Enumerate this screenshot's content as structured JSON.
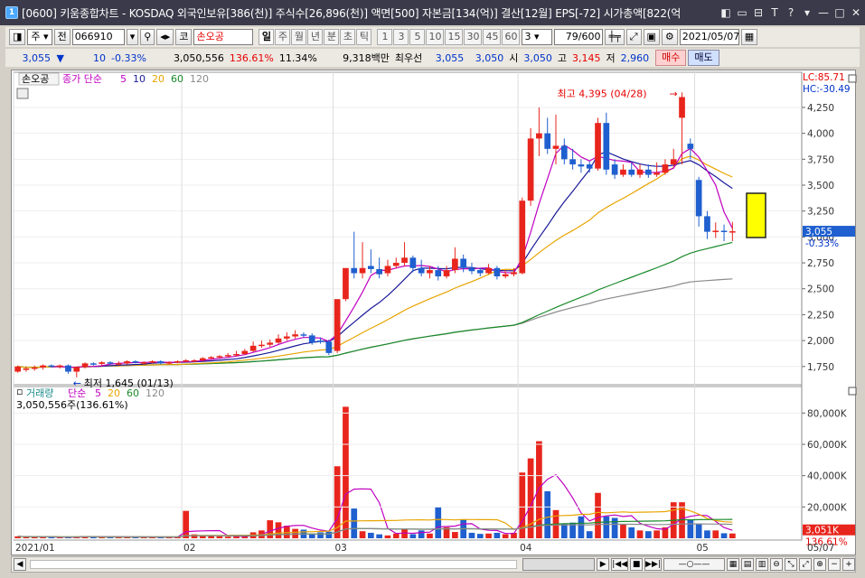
{
  "window": {
    "title": "[0600] 키움종합차트 - KOSDAQ 외국인보유[386(천)] 주식수[26,896(천)] 액면[500] 자본금[134(억)] 결산[12월] EPS[-72] 시가총액[822(억"
  },
  "toolbar": {
    "period_label": "주",
    "prev_label": "전",
    "code_value": "066910",
    "market_label": "코",
    "stock_name": "손오공",
    "period_tabs": [
      "일",
      "주",
      "월",
      "년",
      "분",
      "초",
      "틱"
    ],
    "active_tab": "일",
    "interval_buttons": [
      "1",
      "3",
      "5",
      "10",
      "15",
      "30",
      "45",
      "60"
    ],
    "interval_value": "3",
    "count_value": "79/600",
    "date_value": "2021/05/07"
  },
  "quote": {
    "price": "3,055",
    "change": "10",
    "change_pct": "-0.33%",
    "volume": "3,050,556",
    "vol_ratio": "136.61%",
    "turnover": "11.34%",
    "amount": "9,318백만",
    "best_label": "최우선",
    "best_ask": "3,055",
    "best_bid": "3,050",
    "open_label": "시",
    "open": "3,050",
    "high_label": "고",
    "high": "3,145",
    "low_label": "저",
    "low": "2,960",
    "buy_label": "매수",
    "sell_label": "매도"
  },
  "colors": {
    "up": "#e8251c",
    "down": "#1f5fcf",
    "ma5": "#c000c0",
    "ma10": "#1a1a9a",
    "ma20": "#e8a400",
    "ma60": "#1a8a2a",
    "ma120": "#8a8a8a"
  },
  "price_panel": {
    "legend_name": "손오공",
    "legend_ma": "종가 단순",
    "legend_periods": [
      "5",
      "10",
      "20",
      "60",
      "120"
    ],
    "lc_label": "LC:85.71",
    "hc_label": "HC:-30.49",
    "high_annotation": "최고 4,395 (04/28)",
    "low_annotation": "최저 1,645 (01/13)",
    "current_price": "3,055",
    "current_pct": "-0.33%",
    "yticks": [
      "4,250",
      "4,000",
      "3,750",
      "3,500",
      "3,250",
      "3,000",
      "2,750",
      "2,500",
      "2,250",
      "2,000",
      "1,750"
    ]
  },
  "volume_panel": {
    "legend_name": "거래량",
    "legend_ma": "단순",
    "legend_periods": [
      "5",
      "20",
      "60",
      "120"
    ],
    "value_text": "3,050,556주(136.61%)",
    "yticks": [
      "80,000K",
      "60,000K",
      "40,000K",
      "20,000K"
    ],
    "current_vol": "3,051K",
    "current_pct": "136.61%"
  },
  "xaxis": {
    "labels": [
      "2021/01",
      "02",
      "03",
      "04",
      "05",
      "05/07"
    ]
  },
  "chart_data": {
    "type": "candlestick",
    "title": "손오공",
    "x": [
      "01/04",
      "01/05",
      "01/06",
      "01/07",
      "01/08",
      "01/11",
      "01/12",
      "01/13",
      "01/14",
      "01/15",
      "01/18",
      "01/19",
      "01/20",
      "01/21",
      "01/22",
      "01/25",
      "01/26",
      "01/27",
      "01/28",
      "01/29",
      "02/01",
      "02/02",
      "02/03",
      "02/04",
      "02/05",
      "02/08",
      "02/09",
      "02/10",
      "02/15",
      "02/16",
      "02/17",
      "02/18",
      "02/19",
      "02/22",
      "02/23",
      "02/24",
      "02/25",
      "02/26",
      "03/02",
      "03/03",
      "03/04",
      "03/05",
      "03/08",
      "03/09",
      "03/10",
      "03/11",
      "03/12",
      "03/15",
      "03/16",
      "03/17",
      "03/18",
      "03/19",
      "03/22",
      "03/23",
      "03/24",
      "03/25",
      "03/26",
      "03/29",
      "03/30",
      "03/31",
      "04/01",
      "04/02",
      "04/05",
      "04/06",
      "04/07",
      "04/08",
      "04/09",
      "04/12",
      "04/13",
      "04/14",
      "04/15",
      "04/16",
      "04/19",
      "04/20",
      "04/21",
      "04/22",
      "04/23",
      "04/26",
      "04/27",
      "04/28",
      "04/29",
      "04/30",
      "05/03",
      "05/04",
      "05/06",
      "05/07"
    ],
    "open": [
      1700,
      1720,
      1730,
      1740,
      1760,
      1750,
      1760,
      1700,
      1745,
      1780,
      1775,
      1790,
      1780,
      1780,
      1800,
      1790,
      1790,
      1800,
      1780,
      1790,
      1800,
      1810,
      1810,
      1830,
      1840,
      1850,
      1860,
      1870,
      1900,
      1950,
      1960,
      1980,
      2020,
      2040,
      2060,
      2050,
      2000,
      1990,
      1900,
      2400,
      2700,
      2650,
      2720,
      2690,
      2650,
      2720,
      2750,
      2800,
      2700,
      2650,
      2680,
      2620,
      2680,
      2790,
      2700,
      2680,
      2650,
      2700,
      2620,
      2640,
      2650,
      3350,
      3950,
      4000,
      3850,
      3880,
      3750,
      3700,
      3700,
      3660,
      4100,
      3700,
      3600,
      3650,
      3600,
      3650,
      3600,
      3620,
      3700,
      4150,
      3900,
      3550,
      3200,
      3050,
      3060,
      3050
    ],
    "close": [
      1750,
      1730,
      1740,
      1760,
      1755,
      1760,
      1700,
      1745,
      1780,
      1770,
      1790,
      1780,
      1780,
      1800,
      1790,
      1790,
      1800,
      1780,
      1790,
      1800,
      1810,
      1810,
      1830,
      1840,
      1850,
      1860,
      1870,
      1900,
      1950,
      1960,
      1980,
      2020,
      2040,
      2060,
      2050,
      1980,
      1990,
      1880,
      2400,
      2700,
      2650,
      2700,
      2690,
      2640,
      2720,
      2750,
      2800,
      2700,
      2650,
      2680,
      2620,
      2680,
      2790,
      2700,
      2670,
      2650,
      2700,
      2620,
      2640,
      2660,
      3350,
      3950,
      4000,
      3850,
      3880,
      3750,
      3700,
      3680,
      3660,
      4100,
      3650,
      3600,
      3650,
      3600,
      3650,
      3600,
      3620,
      3700,
      3750,
      4350,
      3850,
      3200,
      3050,
      3060,
      3050,
      3055
    ],
    "high": [
      1760,
      1750,
      1760,
      1770,
      1770,
      1770,
      1770,
      1750,
      1790,
      1790,
      1800,
      1800,
      1800,
      1810,
      1810,
      1800,
      1810,
      1810,
      1800,
      1810,
      1820,
      1820,
      1840,
      1850,
      1860,
      1880,
      1900,
      1920,
      1990,
      2000,
      2010,
      2060,
      2080,
      2100,
      2080,
      2070,
      2030,
      2010,
      2050,
      2500,
      3050,
      2950,
      2880,
      2800,
      2780,
      2800,
      2950,
      2820,
      2780,
      2720,
      2720,
      2720,
      2900,
      2830,
      2750,
      2700,
      2740,
      2720,
      2680,
      2700,
      3380,
      4050,
      4250,
      4150,
      4180,
      3950,
      3850,
      3750,
      3730,
      4150,
      4200,
      3750,
      3700,
      3720,
      3700,
      3700,
      3720,
      3750,
      3850,
      4395,
      3950,
      3580,
      3250,
      3140,
      3120,
      3145
    ],
    "low": [
      1690,
      1700,
      1710,
      1720,
      1740,
      1730,
      1680,
      1645,
      1730,
      1760,
      1760,
      1770,
      1760,
      1770,
      1780,
      1770,
      1780,
      1770,
      1770,
      1780,
      1790,
      1800,
      1800,
      1820,
      1830,
      1840,
      1850,
      1860,
      1890,
      1930,
      1940,
      1970,
      2000,
      2020,
      2030,
      1960,
      1970,
      1860,
      1880,
      2380,
      2600,
      2600,
      2650,
      2600,
      2620,
      2700,
      2720,
      2660,
      2620,
      2600,
      2580,
      2600,
      2650,
      2660,
      2640,
      2620,
      2640,
      2590,
      2600,
      2620,
      2640,
      3300,
      3780,
      3800,
      3700,
      3700,
      3650,
      3620,
      3620,
      3640,
      3600,
      3560,
      3580,
      3580,
      3570,
      3570,
      3580,
      3600,
      3680,
      3700,
      3750,
      3100,
      2980,
      2990,
      2960,
      2960
    ],
    "volume_k": [
      1200,
      900,
      800,
      700,
      900,
      600,
      800,
      1000,
      1200,
      900,
      800,
      700,
      900,
      1100,
      800,
      700,
      600,
      900,
      1000,
      800,
      17500,
      2500,
      1800,
      1500,
      1200,
      1000,
      1100,
      1300,
      3800,
      5000,
      11500,
      10200,
      8000,
      6000,
      5500,
      3000,
      3800,
      4200,
      46000,
      84000,
      19000,
      4500,
      3500,
      2500,
      1800,
      3000,
      6000,
      2600,
      5000,
      3000,
      20000,
      7000,
      4000,
      12000,
      3500,
      2800,
      3000,
      3500,
      2600,
      3500,
      42000,
      51000,
      62000,
      30000,
      18000,
      9000,
      10000,
      14000,
      4500,
      29000,
      14000,
      13000,
      9000,
      7000,
      5000,
      4500,
      5000,
      7000,
      23000,
      23000,
      12000,
      9000,
      5000,
      5000,
      3200,
      3051
    ],
    "ylim": [
      1600,
      4450
    ],
    "volume_ylim": [
      0,
      90000
    ]
  }
}
